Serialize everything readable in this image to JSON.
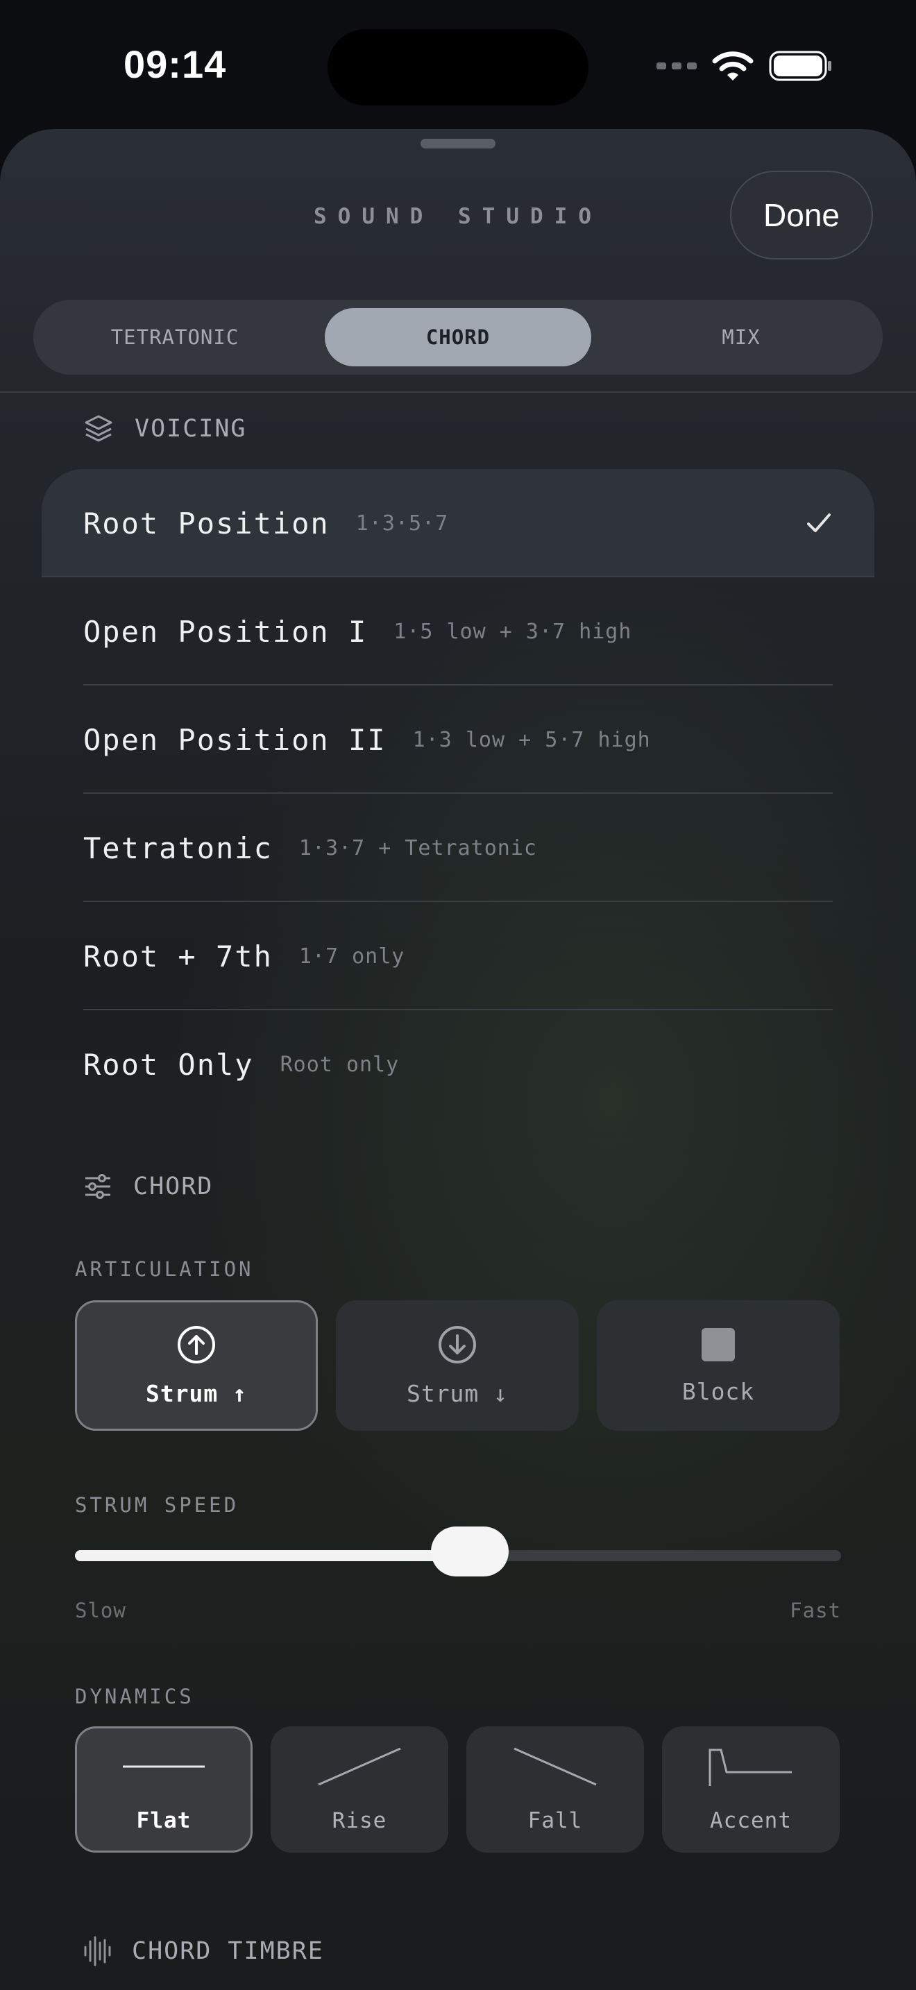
{
  "status_bar": {
    "time": "09:14"
  },
  "sheet": {
    "title": "SOUND STUDIO",
    "done_label": "Done"
  },
  "tabs": [
    {
      "label": "TETRATONIC",
      "active": false
    },
    {
      "label": "CHORD",
      "active": true
    },
    {
      "label": "MIX",
      "active": false
    }
  ],
  "voicing": {
    "header": "VOICING",
    "icon": "layers-icon",
    "items": [
      {
        "title": "Root Position",
        "detail": "1·3·5·7",
        "selected": true
      },
      {
        "title": "Open Position I",
        "detail": "1·5 low + 3·7 high",
        "selected": false
      },
      {
        "title": "Open Position II",
        "detail": "1·3 low + 5·7 high",
        "selected": false
      },
      {
        "title": "Tetratonic",
        "detail": "1·3·7 + Tetratonic",
        "selected": false
      },
      {
        "title": "Root + 7th",
        "detail": "1·7 only",
        "selected": false
      },
      {
        "title": "Root Only",
        "detail": "Root only",
        "selected": false
      }
    ]
  },
  "chord": {
    "header": "CHORD",
    "icon": "sliders-icon",
    "articulation": {
      "label": "ARTICULATION",
      "options": [
        {
          "label": "Strum ↑",
          "icon": "arrow-up-circle-icon",
          "active": true
        },
        {
          "label": "Strum ↓",
          "icon": "arrow-down-circle-icon",
          "active": false
        },
        {
          "label": "Block",
          "icon": "square-icon",
          "active": false
        }
      ]
    },
    "strum_speed": {
      "label": "STRUM SPEED",
      "value": 0.515,
      "min_label": "Slow",
      "max_label": "Fast"
    },
    "dynamics": {
      "label": "DYNAMICS",
      "options": [
        {
          "label": "Flat",
          "icon": "flat-line-icon",
          "active": true
        },
        {
          "label": "Rise",
          "icon": "rise-line-icon",
          "active": false
        },
        {
          "label": "Fall",
          "icon": "fall-line-icon",
          "active": false
        },
        {
          "label": "Accent",
          "icon": "accent-line-icon",
          "active": false
        }
      ]
    }
  },
  "chord_timbre": {
    "header": "CHORD TIMBRE",
    "icon": "waveform-icon"
  },
  "colors": {
    "accent_tab": "#a2a8b2",
    "sheet_bg": "#23272c",
    "text_primary": "#eef0f2"
  }
}
